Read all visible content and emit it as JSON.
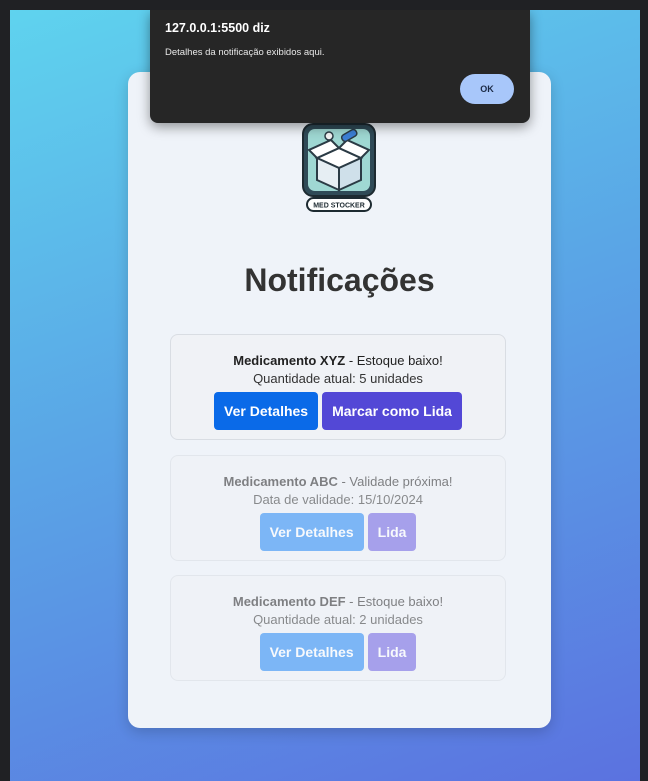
{
  "dialog": {
    "host": "127.0.0.1:5500 diz",
    "message": "Detalhes da notificação exibidos aqui.",
    "ok_label": "OK"
  },
  "logo": {
    "text": "MED STOCKER"
  },
  "page": {
    "title": "Notificações"
  },
  "notifications": [
    {
      "name": "Medicamento XYZ",
      "status": " - Estoque baixo!",
      "detail": "Quantidade atual: 5 unidades",
      "details_label": "Ver Detalhes",
      "action_label": "Marcar como Lida"
    },
    {
      "name": "Medicamento ABC",
      "status": " - Validade próxima!",
      "detail": "Data de validade: 15/10/2024",
      "details_label": "Ver Detalhes",
      "action_label": "Lida"
    },
    {
      "name": "Medicamento DEF",
      "status": " - Estoque baixo!",
      "detail": "Quantidade atual: 2 unidades",
      "details_label": "Ver Detalhes",
      "action_label": "Lida"
    }
  ]
}
